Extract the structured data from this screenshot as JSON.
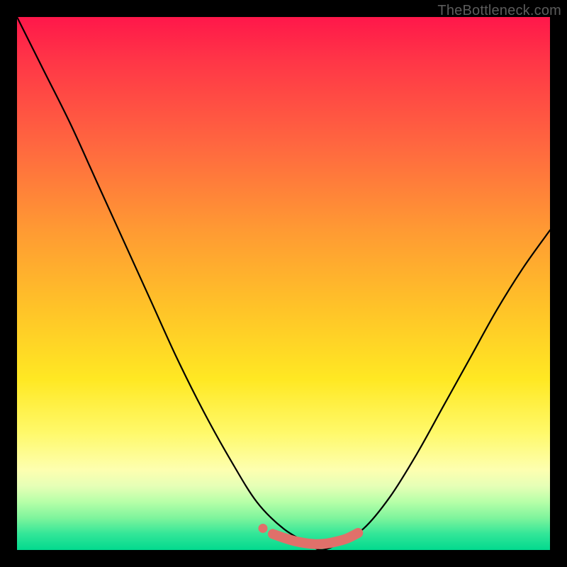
{
  "watermark": "TheBottleneck.com",
  "chart_data": {
    "type": "line",
    "title": "",
    "xlabel": "",
    "ylabel": "",
    "xlim": [
      0,
      100
    ],
    "ylim": [
      0,
      100
    ],
    "grid": false,
    "legend": false,
    "background_gradient_colors": [
      "#ff174a",
      "#ff3547",
      "#ff6a3f",
      "#ff9a33",
      "#ffc428",
      "#ffe823",
      "#fff96a",
      "#fdffb0",
      "#e6ffb6",
      "#b6ffa8",
      "#7ef49c",
      "#32e698",
      "#02d98e"
    ],
    "series": [
      {
        "name": "bottleneck-curve",
        "color": "#000000",
        "x": [
          0,
          5,
          10,
          15,
          20,
          25,
          30,
          35,
          40,
          45,
          50,
          55,
          57,
          60,
          65,
          70,
          75,
          80,
          85,
          90,
          95,
          100
        ],
        "y": [
          100,
          90,
          80,
          69,
          58,
          47,
          36,
          26,
          17,
          9,
          4,
          1,
          0,
          1,
          4,
          10,
          18,
          27,
          36,
          45,
          53,
          60
        ]
      },
      {
        "name": "optimal-range-marker",
        "color": "#e0706a",
        "marker": "dot",
        "x": [
          48,
          50,
          52,
          54,
          56,
          58,
          60,
          62,
          64
        ],
        "y": [
          3,
          2.3,
          1.7,
          1.3,
          1.1,
          1.2,
          1.6,
          2.2,
          3.2
        ]
      }
    ],
    "annotations": []
  }
}
